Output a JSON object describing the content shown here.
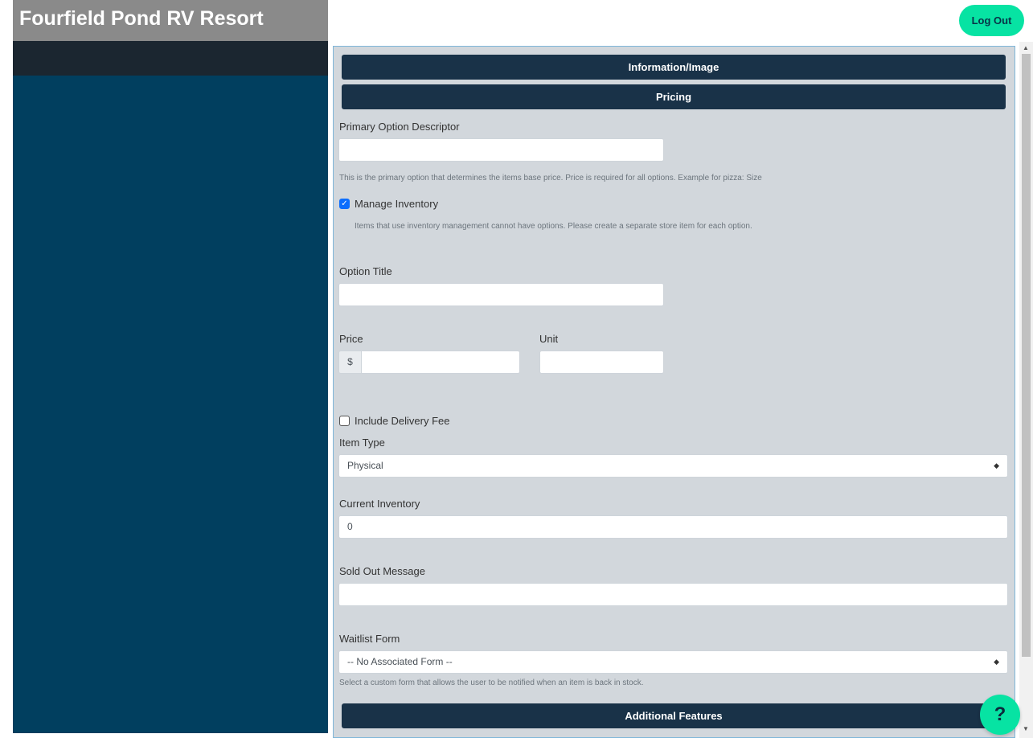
{
  "app": {
    "title": "Fourfield Pond RV Resort"
  },
  "header": {
    "logout_label": "Log Out"
  },
  "sections": {
    "info_image": "Information/Image",
    "pricing": "Pricing",
    "additional": "Additional Features"
  },
  "form": {
    "primary_option": {
      "label": "Primary Option Descriptor",
      "value": "",
      "help": "This is the primary option that determines the items base price. Price is required for all options. Example for pizza: Size"
    },
    "manage_inventory": {
      "label": "Manage Inventory",
      "checked": true,
      "help": "Items that use inventory management cannot have options. Please create a separate store item for each option."
    },
    "option_title": {
      "label": "Option Title",
      "value": ""
    },
    "price": {
      "label": "Price",
      "prefix": "$",
      "value": ""
    },
    "unit": {
      "label": "Unit",
      "value": ""
    },
    "delivery_fee": {
      "label": "Include Delivery Fee",
      "checked": false
    },
    "item_type": {
      "label": "Item Type",
      "value": "Physical"
    },
    "current_inventory": {
      "label": "Current Inventory",
      "value": "0"
    },
    "sold_out": {
      "label": "Sold Out Message",
      "value": ""
    },
    "waitlist": {
      "label": "Waitlist Form",
      "value": "-- No Associated Form --",
      "help": "Select a custom form that allows the user to be notified when an item is back in stock."
    }
  },
  "help_button": {
    "label": "?"
  },
  "colors": {
    "accent": "#07e3a3",
    "sidebar": "#013f5f",
    "section": "#193248",
    "panel": "#d2d7dc"
  }
}
